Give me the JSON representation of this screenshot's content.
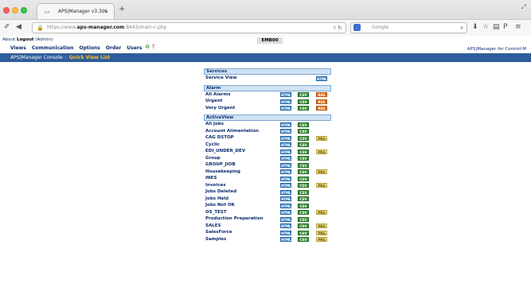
{
  "browser": {
    "tab_title": "APS|Manager v3.30a",
    "tab_close": "×",
    "new_tab": "+",
    "url_prefix": "https://www.",
    "url_domain": "aps-manager.com",
    "url_suffix": ":8443/main-c.php",
    "search_placeholder": "Google"
  },
  "header": {
    "about": "About",
    "logout": "Logout",
    "user": "(Admin)",
    "server": "EMB00",
    "app_title": "APS|Manager for Control-M",
    "menu": [
      "Views",
      "Communication",
      "Options",
      "Order",
      "Users"
    ]
  },
  "breadcrumb": {
    "root": "APS|Manager Console",
    "separator": ":",
    "current": "Quick View List"
  },
  "buttons": {
    "html": "HTML",
    "csv": "CSV",
    "rss": "RSS",
    "png": "PNG"
  },
  "sections": [
    {
      "title": "Services",
      "items": [
        {
          "label": "Service View",
          "html": true,
          "csv": false,
          "rss": false,
          "png": false,
          "html_right": true
        }
      ]
    },
    {
      "title": "Alarm",
      "items": [
        {
          "label": "All Alarms",
          "html": true,
          "csv": true,
          "rss": true,
          "png": false
        },
        {
          "label": "Urgent",
          "html": true,
          "csv": true,
          "rss": true,
          "png": false
        },
        {
          "label": "Very Urgent",
          "html": true,
          "csv": true,
          "rss": true,
          "png": false
        }
      ]
    },
    {
      "title": "ActiveView",
      "items": [
        {
          "label": "All Jobs",
          "html": true,
          "csv": true,
          "rss": false,
          "png": false
        },
        {
          "label": "Account Alimentation",
          "html": true,
          "csv": true,
          "rss": false,
          "png": false
        },
        {
          "label": "CAG DSTOP",
          "html": true,
          "csv": true,
          "rss": false,
          "png": true
        },
        {
          "label": "Cyclic",
          "html": true,
          "csv": true,
          "rss": false,
          "png": false
        },
        {
          "label": "EDI_UNDER_DEV",
          "html": true,
          "csv": true,
          "rss": false,
          "png": true
        },
        {
          "label": "Group",
          "html": true,
          "csv": true,
          "rss": false,
          "png": false
        },
        {
          "label": "GROUP_JIOB",
          "html": true,
          "csv": true,
          "rss": false,
          "png": false
        },
        {
          "label": "Housekeeping",
          "html": true,
          "csv": true,
          "rss": false,
          "png": true
        },
        {
          "label": "INES",
          "html": true,
          "csv": true,
          "rss": false,
          "png": false
        },
        {
          "label": "Invoices",
          "html": true,
          "csv": true,
          "rss": false,
          "png": true
        },
        {
          "label": "Jobs Deleted",
          "html": true,
          "csv": true,
          "rss": false,
          "png": false
        },
        {
          "label": "Jobs Held",
          "html": true,
          "csv": true,
          "rss": false,
          "png": false
        },
        {
          "label": "Jobs Not OK",
          "html": true,
          "csv": true,
          "rss": false,
          "png": false
        },
        {
          "label": "OS_TEST",
          "html": true,
          "csv": true,
          "rss": false,
          "png": true
        },
        {
          "label": "Production Preparation",
          "html": true,
          "csv": true,
          "rss": false,
          "png": false
        },
        {
          "label": "SALES",
          "html": true,
          "csv": true,
          "rss": false,
          "png": true
        },
        {
          "label": "SalesForce",
          "html": true,
          "csv": true,
          "rss": false,
          "png": true
        },
        {
          "label": "Samples",
          "html": true,
          "csv": true,
          "rss": false,
          "png": true
        }
      ]
    }
  ]
}
